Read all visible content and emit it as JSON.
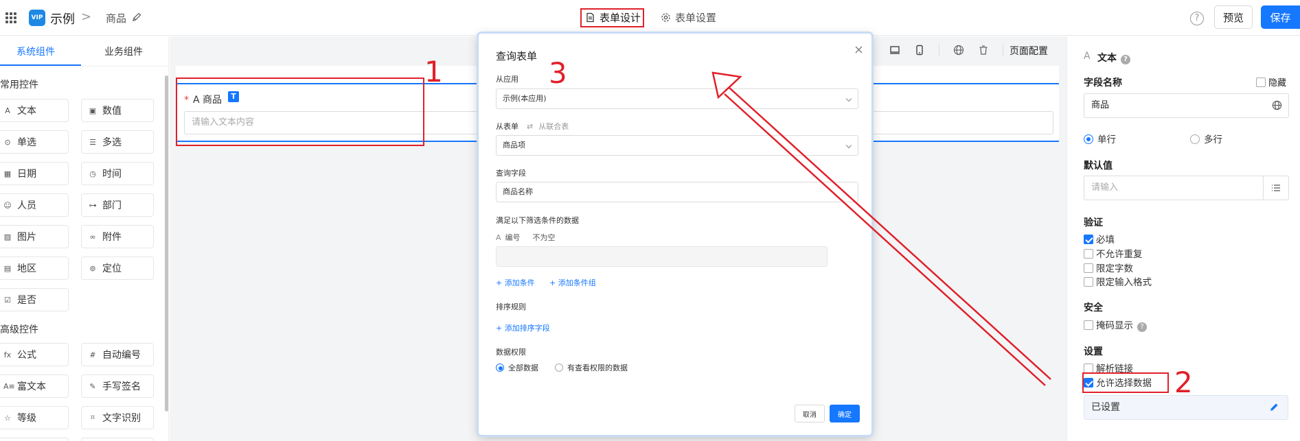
{
  "header": {
    "app_name": "示例",
    "logo_text": "VIP",
    "separator": ">",
    "page_name": "商品",
    "tab_design": "表单设计",
    "tab_settings": "表单设置",
    "help": "?",
    "preview": "预览",
    "save": "保存"
  },
  "left_panel": {
    "tabs": [
      "系统组件",
      "业务组件"
    ],
    "group_common": "常用控件",
    "common": [
      {
        "icon": "A",
        "label": "文本"
      },
      {
        "icon": "▣",
        "label": "数值"
      },
      {
        "icon": "⊙",
        "label": "单选"
      },
      {
        "icon": "☰",
        "label": "多选"
      },
      {
        "icon": "▦",
        "label": "日期"
      },
      {
        "icon": "◷",
        "label": "时间"
      },
      {
        "icon": "☺",
        "label": "人员"
      },
      {
        "icon": "⊶",
        "label": "部门"
      },
      {
        "icon": "▨",
        "label": "图片"
      },
      {
        "icon": "∞",
        "label": "附件"
      },
      {
        "icon": "▤",
        "label": "地区"
      },
      {
        "icon": "⊚",
        "label": "定位"
      },
      {
        "icon": "☑",
        "label": "是否"
      }
    ],
    "group_advanced": "高级控件",
    "advanced": [
      {
        "icon": "fx",
        "label": "公式"
      },
      {
        "icon": "#",
        "label": "自动编号"
      },
      {
        "icon": "A≡",
        "label": "富文本"
      },
      {
        "icon": "✎",
        "label": "手写签名"
      },
      {
        "icon": "☆",
        "label": "等级"
      },
      {
        "icon": "⌗",
        "label": "文字识别"
      }
    ]
  },
  "canvas": {
    "field_label": "商品",
    "field_type": "A",
    "required_mark": "*",
    "type_badge": "T",
    "placeholder": "请输入文本内容",
    "page_config": "页面配置"
  },
  "modal": {
    "title": "查询表单",
    "from_app_label": "从应用",
    "from_app_value": "示例(本应用)",
    "from_form_label": "从表单",
    "from_join_label": "从联合表",
    "from_form_value": "商品项",
    "query_field_label": "查询字段",
    "query_field_value": "商品名称",
    "filter_label": "满足以下筛选条件的数据",
    "condition_field": "编号",
    "condition_op": "不为空",
    "add_condition": "+ 添加条件",
    "add_condition_group": "+ 添加条件组",
    "sort_label": "排序规则",
    "add_sort": "+ 添加排序字段",
    "permission_label": "数据权限",
    "perm_all": "全部数据",
    "perm_view": "有查看权限的数据",
    "cancel": "取消",
    "ok": "确定"
  },
  "right_panel": {
    "type_icon": "A",
    "type_label": "文本",
    "field_name_label": "字段名称",
    "hide_label": "隐藏",
    "field_name_value": "商品",
    "single_line": "单行",
    "multi_line": "多行",
    "default_label": "默认值",
    "default_placeholder": "请输入",
    "validation_label": "验证",
    "v_required": "必填",
    "v_unique": "不允许重复",
    "v_length": "限定字数",
    "v_format": "限定输入格式",
    "security_label": "安全",
    "mask": "掩码显示",
    "settings_label": "设置",
    "parse_link": "解析链接",
    "allow_select": "允许选择数据",
    "configured": "已设置"
  },
  "annotations": {
    "n1": "1",
    "n2": "2",
    "n3": "3",
    "color": "#e0202a"
  },
  "colors": {
    "accent": "#1677ff",
    "annotation": "#e0202a"
  }
}
